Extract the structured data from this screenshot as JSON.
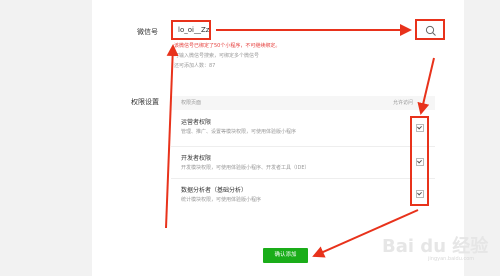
{
  "form": {
    "wechat_label": "微信号",
    "wechat_value": "lo_oi__Zzzz",
    "error_text": "该微信号已绑定了50个小程序，不可继续绑定。",
    "hint_line1": "可输入微信号搜索，可绑定多个微信号",
    "hint_line2": "还可添加人数：87",
    "permission_label": "权限设置"
  },
  "table": {
    "col_page": "权限页面",
    "col_allow": "允许访问"
  },
  "permissions": [
    {
      "title": "运营者权限",
      "desc": "管理、推广、设置等模块权限，可使用体验版小程序",
      "checked": true
    },
    {
      "title": "开发者权限",
      "desc": "开发模块权限，可使用体验版小程序、开发者工具（IDE）",
      "checked": true
    },
    {
      "title": "数据分析者（基础分析）",
      "desc": "统计模块权限，可使用体验版小程序",
      "checked": true
    }
  ],
  "buttons": {
    "confirm": "确认添加"
  },
  "watermark": {
    "main": "Bai du 经验",
    "sub": "jingyan.baidu.com"
  },
  "colors": {
    "annotation": "#e8321b",
    "primary": "#1aad19"
  }
}
